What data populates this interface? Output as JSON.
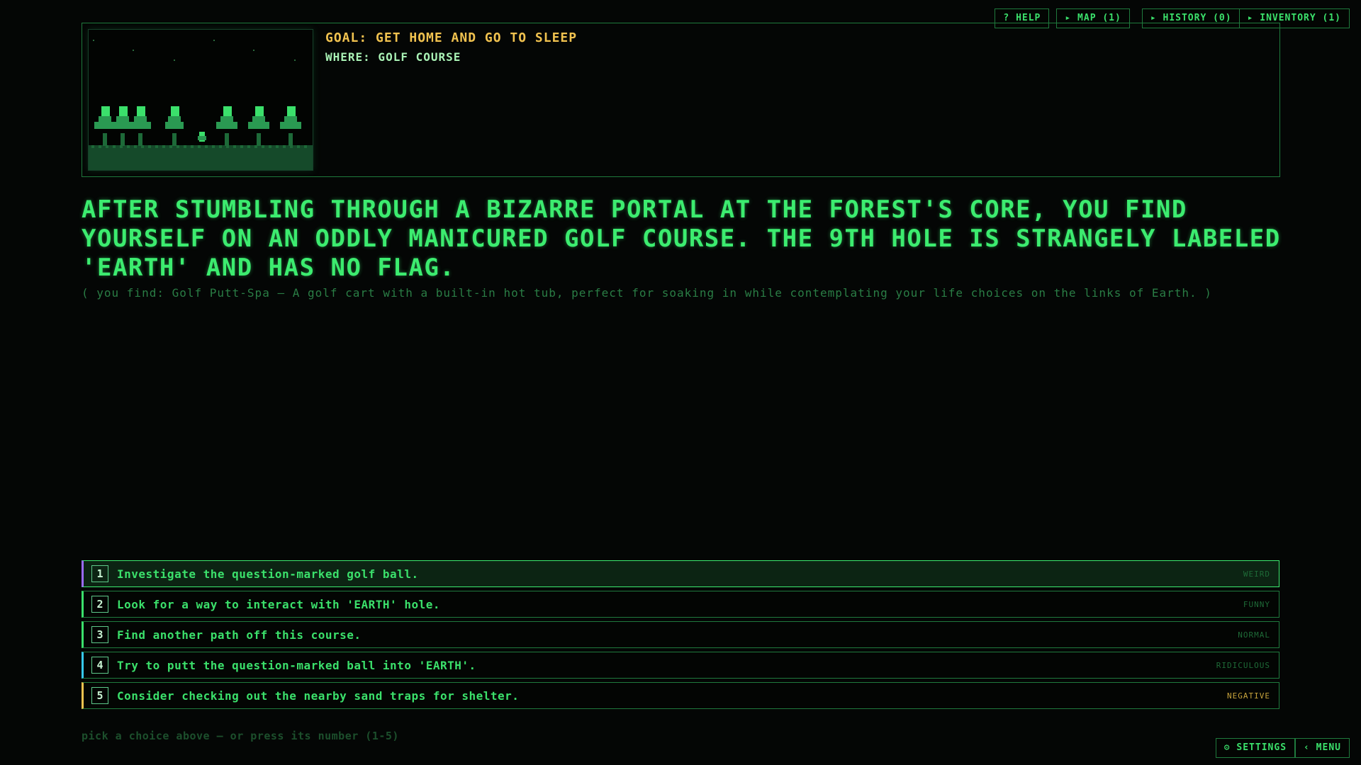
{
  "nav": {
    "help": "? HELP",
    "map": "▸ MAP (1)",
    "history": "▸ HISTORY (0)",
    "inventory": "▸ INVENTORY (1)"
  },
  "scene": {
    "goal": "GOAL: GET HOME AND GO TO SLEEP",
    "where": "WHERE: GOLF COURSE"
  },
  "narrative": "AFTER STUMBLING THROUGH A BIZARRE PORTAL AT THE FOREST'S CORE, YOU FIND YOURSELF ON AN ODDLY MANICURED GOLF COURSE. THE 9TH HOLE IS STRANGELY LABELED 'EARTH' AND HAS NO FLAG.",
  "found": "( you find: Golf Putt-Spa — A golf cart with a built-in hot tub, perfect for soaking in while contemplating your life choices on the links of Earth. )",
  "choices": [
    {
      "num": "1",
      "text": "Investigate the question-marked golf ball.",
      "tag": "WEIRD",
      "accent": "#9b6bff"
    },
    {
      "num": "2",
      "text": "Look for a way to interact with 'EARTH' hole.",
      "tag": "FUNNY",
      "accent": "#3be06b"
    },
    {
      "num": "3",
      "text": "Find another path off this course.",
      "tag": "NORMAL",
      "accent": "#3be06b"
    },
    {
      "num": "4",
      "text": "Try to putt the question-marked ball into 'EARTH'.",
      "tag": "RIDICULOUS",
      "accent": "#36c9f0"
    },
    {
      "num": "5",
      "text": "Consider checking out the nearby sand traps for shelter.",
      "tag": "NEGATIVE",
      "accent": "#f0c24f"
    }
  ],
  "hint": "pick a choice above — or press its number (1-5)",
  "bottom": {
    "settings": "⚙ SETTINGS",
    "menu": "‹ MENU"
  },
  "colors": {
    "background": "#040605",
    "primary_green": "#3be06b",
    "goal_yellow": "#f0c24f",
    "border_green": "#1f7a3d"
  }
}
